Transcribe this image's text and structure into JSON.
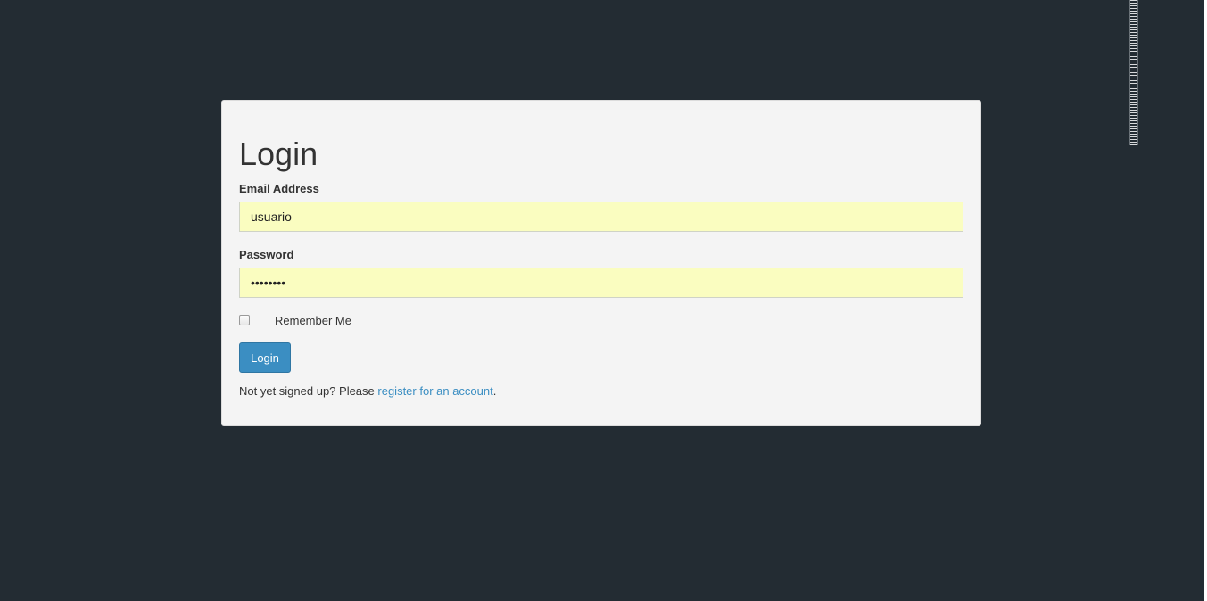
{
  "form": {
    "title": "Login",
    "email_label": "Email Address",
    "email_value": "usuario",
    "password_label": "Password",
    "password_value": "usuario1",
    "remember_label": "Remember Me",
    "remember_checked": false,
    "login_button": "Login",
    "signup_prefix": "Not yet signed up? Please ",
    "signup_link": "register for an account",
    "signup_suffix": "."
  },
  "colors": {
    "background": "#232c33",
    "card": "#f4f4f4",
    "field_autofill": "#fafdc0",
    "accent": "#3b8ec2"
  }
}
